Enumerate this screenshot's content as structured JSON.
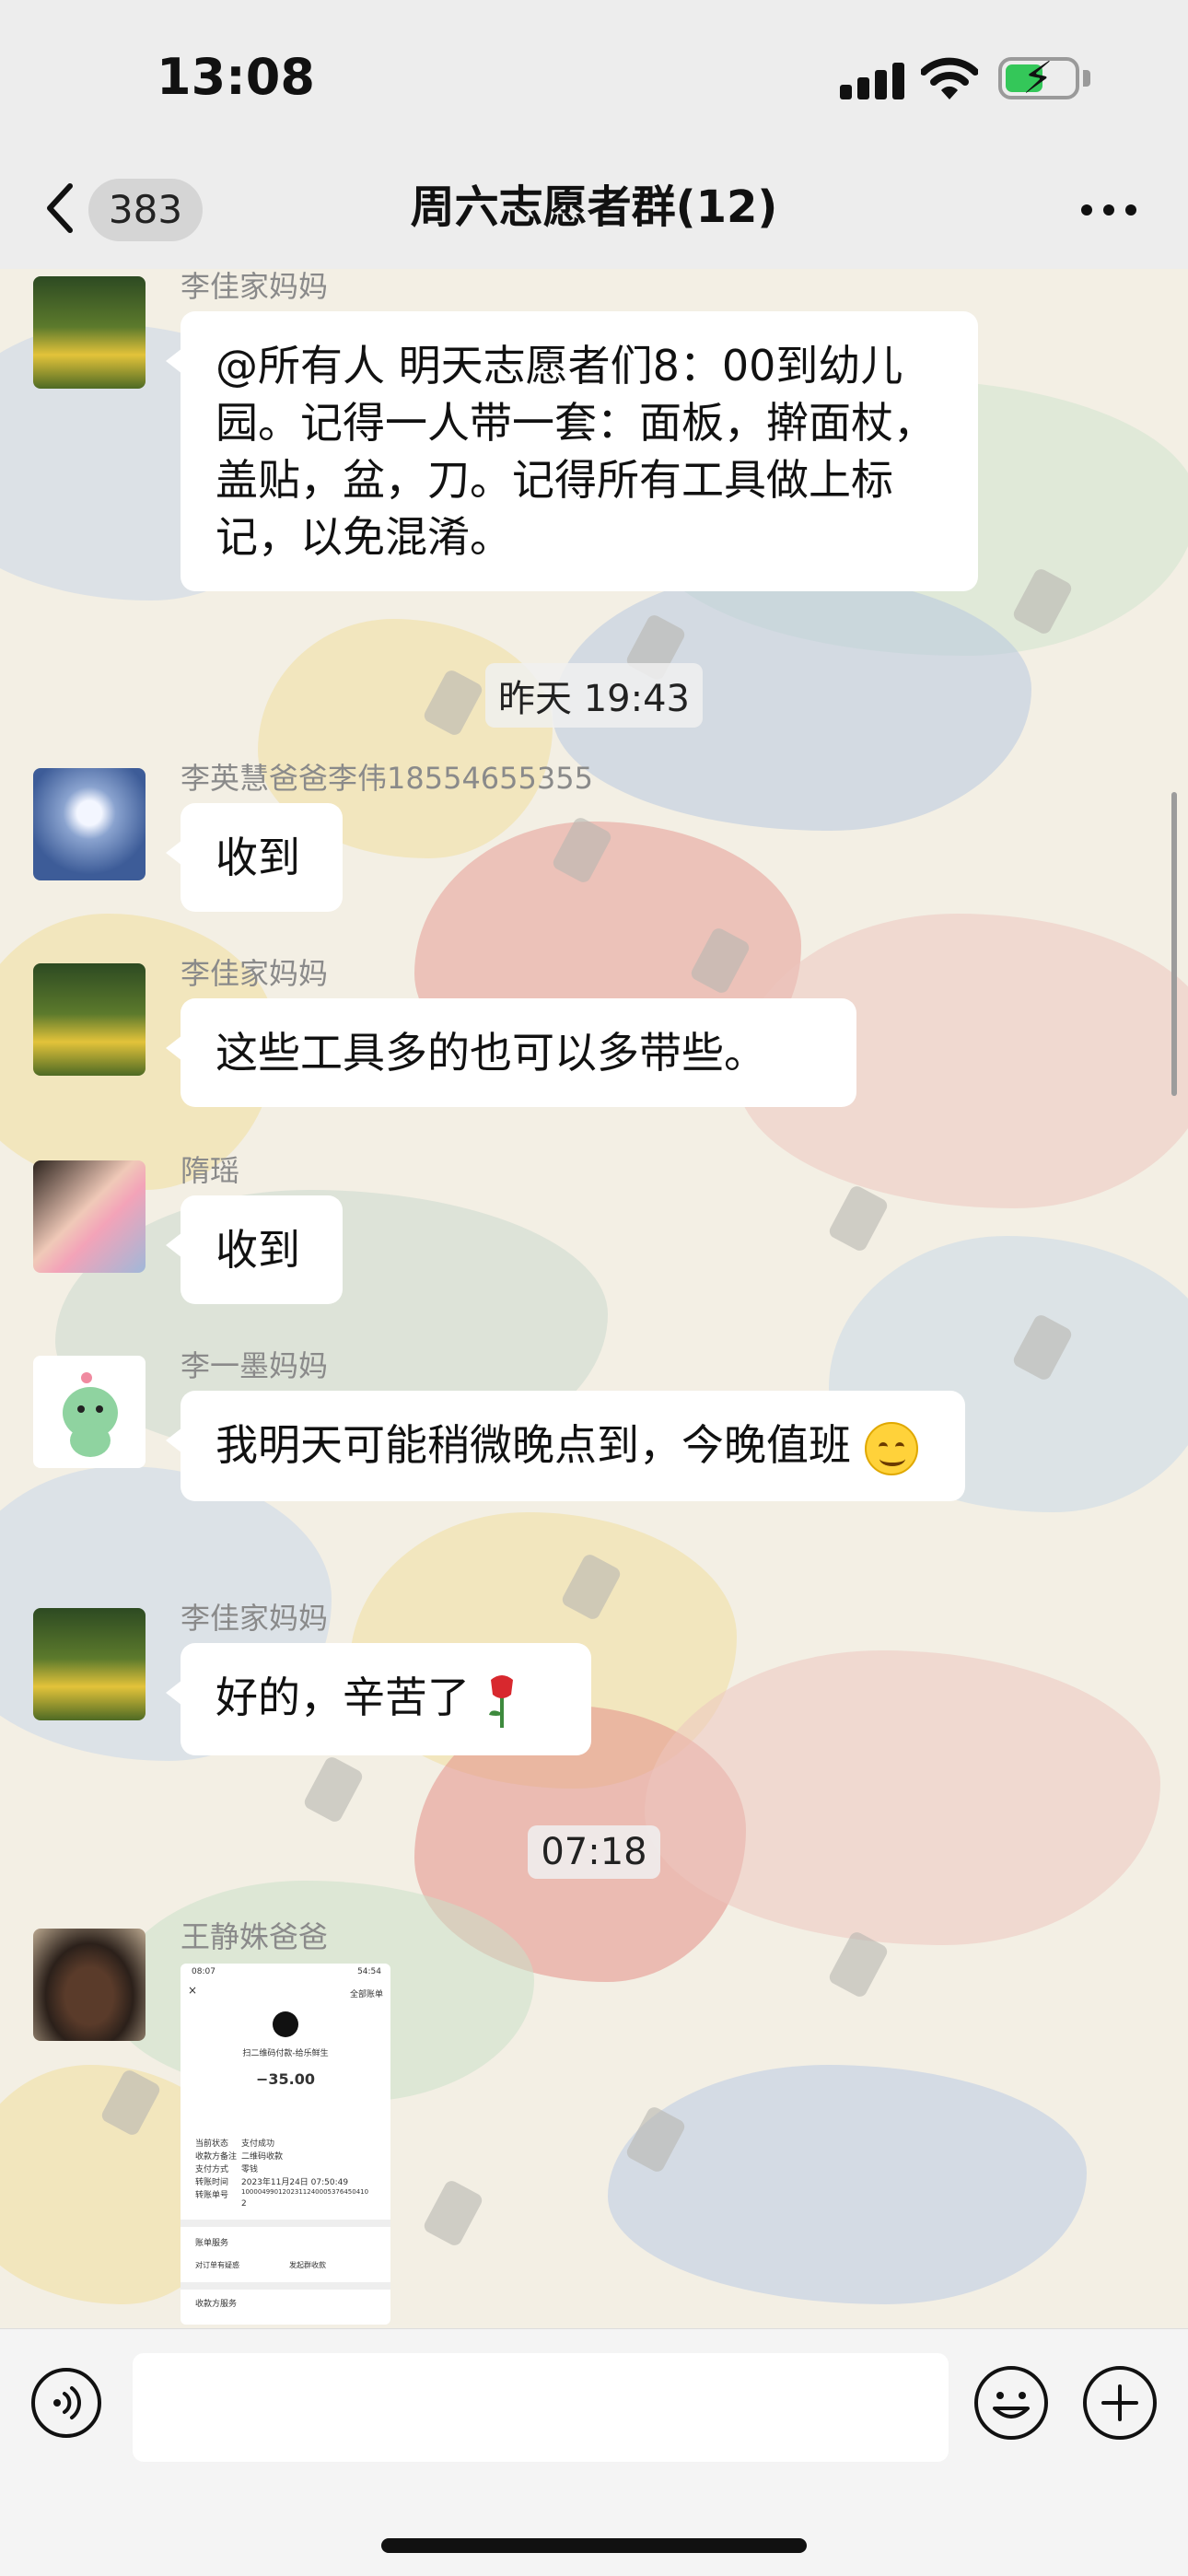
{
  "status_bar": {
    "time": "13:08",
    "battery_level": 0.55
  },
  "nav": {
    "unread_count": "383",
    "title": "周六志愿者群(12)"
  },
  "messages": [
    {
      "sender": "李佳家妈妈",
      "text": "@所有人 明天志愿者们8：00到幼儿园。记得一人带一套：面板，擀面杖，盖贴，盆，刀。记得所有工具做上标记，以免混淆。",
      "avatar": "flower-avatar"
    },
    {
      "timestamp": "昨天 19:43"
    },
    {
      "sender": "李英慧爸爸李伟18554655355",
      "text": "收到",
      "avatar": "dandelion-avatar"
    },
    {
      "sender": "李佳家妈妈",
      "text": "这些工具多的也可以多带些。",
      "avatar": "flower-avatar"
    },
    {
      "sender": "隋瑶",
      "text": "收到",
      "avatar": "portrait-avatar"
    },
    {
      "sender": "李一墨妈妈",
      "text": "我明天可能稍微晚点到，今晚值班",
      "emoji": "smiling-face-icon",
      "avatar": "dinosaur-avatar"
    },
    {
      "sender": "李佳家妈妈",
      "text": "好的，辛苦了",
      "emoji": "rose-icon",
      "avatar": "flower-avatar"
    },
    {
      "timestamp": "07:18"
    },
    {
      "sender": "王静姝爸爸",
      "avatar": "teapot-avatar",
      "image": {
        "status_time": "08:07",
        "status_right": "54:54",
        "header_right": "全部账单",
        "merchant": "扫二维码付款-给乐鲜生",
        "amount": "−35.00",
        "rows": [
          {
            "label": "当前状态",
            "value": "支付成功"
          },
          {
            "label": "收款方备注",
            "value": "二维码收款"
          },
          {
            "label": "支付方式",
            "value": "零钱"
          },
          {
            "label": "转账时间",
            "value": "2023年11月24日 07:50:49"
          },
          {
            "label": "转账单号",
            "value": "1000049901202311240005376450410"
          }
        ],
        "row_tail": "2",
        "section1": "账单服务",
        "link1": "对订单有疑惑",
        "link2": "发起群收款",
        "section2": "收款方服务"
      }
    }
  ],
  "colors": {
    "bubble": "#ffffff",
    "accent_battery": "#34c759",
    "bar_bg": "#ededed"
  }
}
